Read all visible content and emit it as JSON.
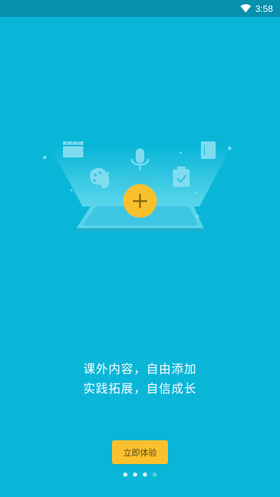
{
  "status_bar": {
    "time": "3:58",
    "icons": [
      "wifi-icon"
    ]
  },
  "onboarding": {
    "illustration_icons": [
      "clapperboard-icon",
      "palette-icon",
      "microphone-icon",
      "clipboard-check-icon",
      "book-icon",
      "plus-icon",
      "tablet-icon"
    ],
    "tagline_line_1": "课外内容，自由添加",
    "tagline_line_2": "实践拓展，自信成长",
    "cta_label": "立即体验",
    "page_indicator": {
      "total": 4,
      "current_index": 3
    }
  },
  "colors": {
    "background": "#0ab6d8",
    "status_bar": "#0791ad",
    "accent": "#fbc02d"
  }
}
